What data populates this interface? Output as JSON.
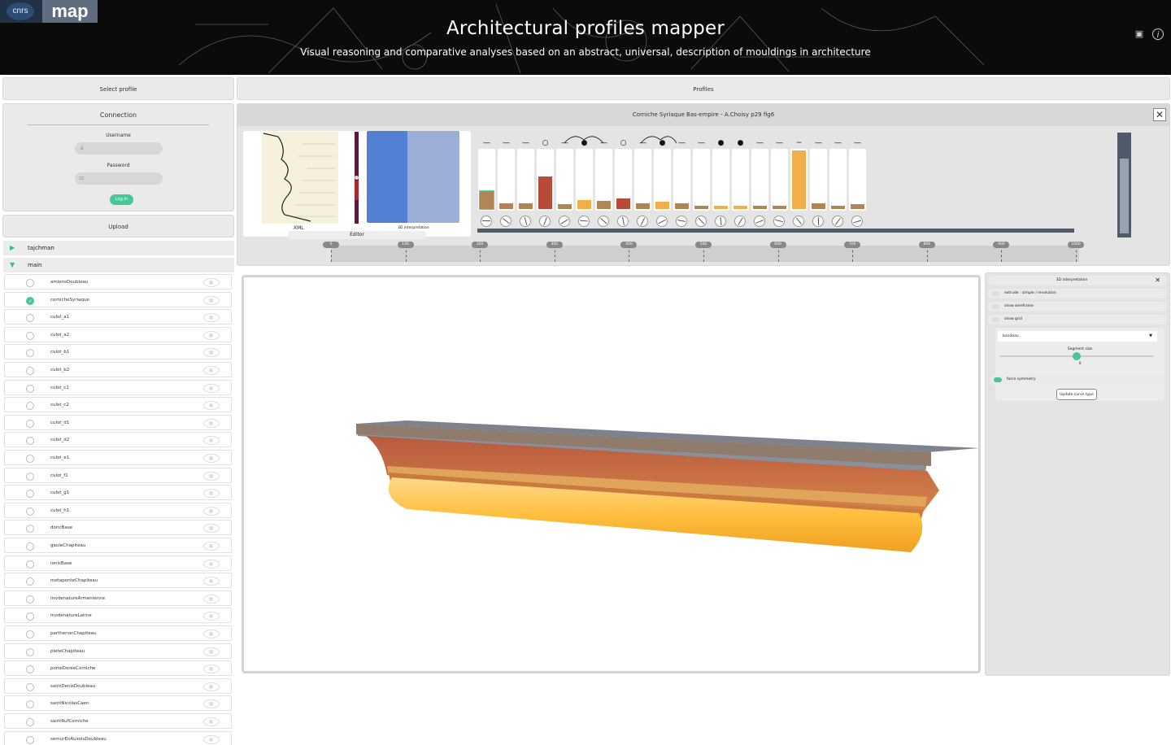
{
  "header": {
    "logo_cnrs": "cnrs",
    "logo_map": "map",
    "title": "Architectural profiles mapper",
    "subtitle": "Visual reasoning and comparative analyses based on an abstract, universal, description of mouldings in architecture",
    "icons": [
      "save-icon",
      "info-icon"
    ]
  },
  "sidebar": {
    "select_profile": "Select profile",
    "connection": {
      "title": "Connection",
      "username_label": "Username",
      "password_label": "Password",
      "login_label": "Log in"
    },
    "upload": "Upload",
    "groups": [
      {
        "name": "tajchman",
        "expanded": false
      },
      {
        "name": "main",
        "expanded": true
      }
    ],
    "profiles": [
      {
        "name": "amiensDoubleau",
        "selected": false
      },
      {
        "name": "cornicheSyriaque",
        "selected": true
      },
      {
        "name": "culot_a1",
        "selected": false
      },
      {
        "name": "culot_a2",
        "selected": false
      },
      {
        "name": "culot_b1",
        "selected": false
      },
      {
        "name": "culot_b2",
        "selected": false
      },
      {
        "name": "culot_c1",
        "selected": false
      },
      {
        "name": "culot_c2",
        "selected": false
      },
      {
        "name": "culot_d1",
        "selected": false
      },
      {
        "name": "culot_d2",
        "selected": false
      },
      {
        "name": "culot_e1",
        "selected": false
      },
      {
        "name": "culot_f1",
        "selected": false
      },
      {
        "name": "culot_g1",
        "selected": false
      },
      {
        "name": "culot_h1",
        "selected": false
      },
      {
        "name": "doricBase",
        "selected": false
      },
      {
        "name": "gauleChapiteau",
        "selected": false
      },
      {
        "name": "ionicBase",
        "selected": false
      },
      {
        "name": "metaponteChapiteau",
        "selected": false
      },
      {
        "name": "modenatureArmenienne",
        "selected": false
      },
      {
        "name": "modenatureLatine",
        "selected": false
      },
      {
        "name": "parthenonChapiteau",
        "selected": false
      },
      {
        "name": "pleteChapiteau",
        "selected": false
      },
      {
        "name": "porteDoreeCorniche",
        "selected": false
      },
      {
        "name": "saintDenisDoubleau",
        "selected": false
      },
      {
        "name": "saintNicolasCaen",
        "selected": false
      },
      {
        "name": "saintRufCorniche",
        "selected": false
      },
      {
        "name": "semurEnAuxoisDoubleau",
        "selected": false
      }
    ]
  },
  "profiles_panel": {
    "title": "Profiles",
    "profile_name": "Corniche Syriaque Bas-empire - A.Choisy p29 fig6",
    "xml_label": "XML",
    "interp_label": "3D interpretation",
    "editor_label": "Editor",
    "bars": [
      {
        "symbol": "—",
        "level": 0.3,
        "color": "#b08558",
        "selected": true
      },
      {
        "symbol": "—",
        "level": 0.1,
        "color": "#b08558"
      },
      {
        "symbol": "—",
        "level": 0.1,
        "color": "#b08558"
      },
      {
        "symbol": "○",
        "level": 0.55,
        "color": "#b84a3a"
      },
      {
        "symbol": "—",
        "level": 0.08,
        "color": "#b08558"
      },
      {
        "symbol": "●",
        "level": 0.15,
        "color": "#f2ae4a"
      },
      {
        "symbol": "—",
        "level": 0.14,
        "color": "#b08558"
      },
      {
        "symbol": "○",
        "level": 0.18,
        "color": "#b84a3a"
      },
      {
        "symbol": "—",
        "level": 0.1,
        "color": "#b08558"
      },
      {
        "symbol": "●",
        "level": 0.12,
        "color": "#f2ae4a"
      },
      {
        "symbol": "—",
        "level": 0.1,
        "color": "#b08558"
      },
      {
        "symbol": "—",
        "level": 0.06,
        "color": "#b08558"
      },
      {
        "symbol": "●",
        "level": 0.06,
        "color": "#f2ae4a"
      },
      {
        "symbol": "●",
        "level": 0.06,
        "color": "#f2ae4a"
      },
      {
        "symbol": "—",
        "level": 0.06,
        "color": "#b08558"
      },
      {
        "symbol": "—",
        "level": 0.06,
        "color": "#b08558"
      },
      {
        "symbol": "~",
        "level": 1.0,
        "color": "#f2ae4a"
      },
      {
        "symbol": "—",
        "level": 0.1,
        "color": "#b08558"
      },
      {
        "symbol": "—",
        "level": 0.06,
        "color": "#b08558"
      },
      {
        "symbol": "—",
        "level": 0.08,
        "color": "#b08558"
      }
    ],
    "ruler_ticks": [
      "0",
      "100",
      "200",
      "300",
      "400",
      "500",
      "600",
      "700",
      "800",
      "900",
      "1000"
    ]
  },
  "controls": {
    "title": "3D interpretation",
    "toggles": [
      {
        "label": "extrude : simple / revolution",
        "on": false
      },
      {
        "label": "show wireframe",
        "on": false
      },
      {
        "label": "show grid",
        "on": false
      }
    ],
    "curve_type": "bandeau",
    "segment_label": "Segment size",
    "segment_value": "0",
    "force_symmetry": "force symmetry",
    "update_button": "Update curve type"
  },
  "colors": {
    "accent": "#46c796",
    "brown": "#b08558",
    "orange": "#f2ae4a",
    "red": "#b84a3a",
    "blue": "#5480d4"
  }
}
